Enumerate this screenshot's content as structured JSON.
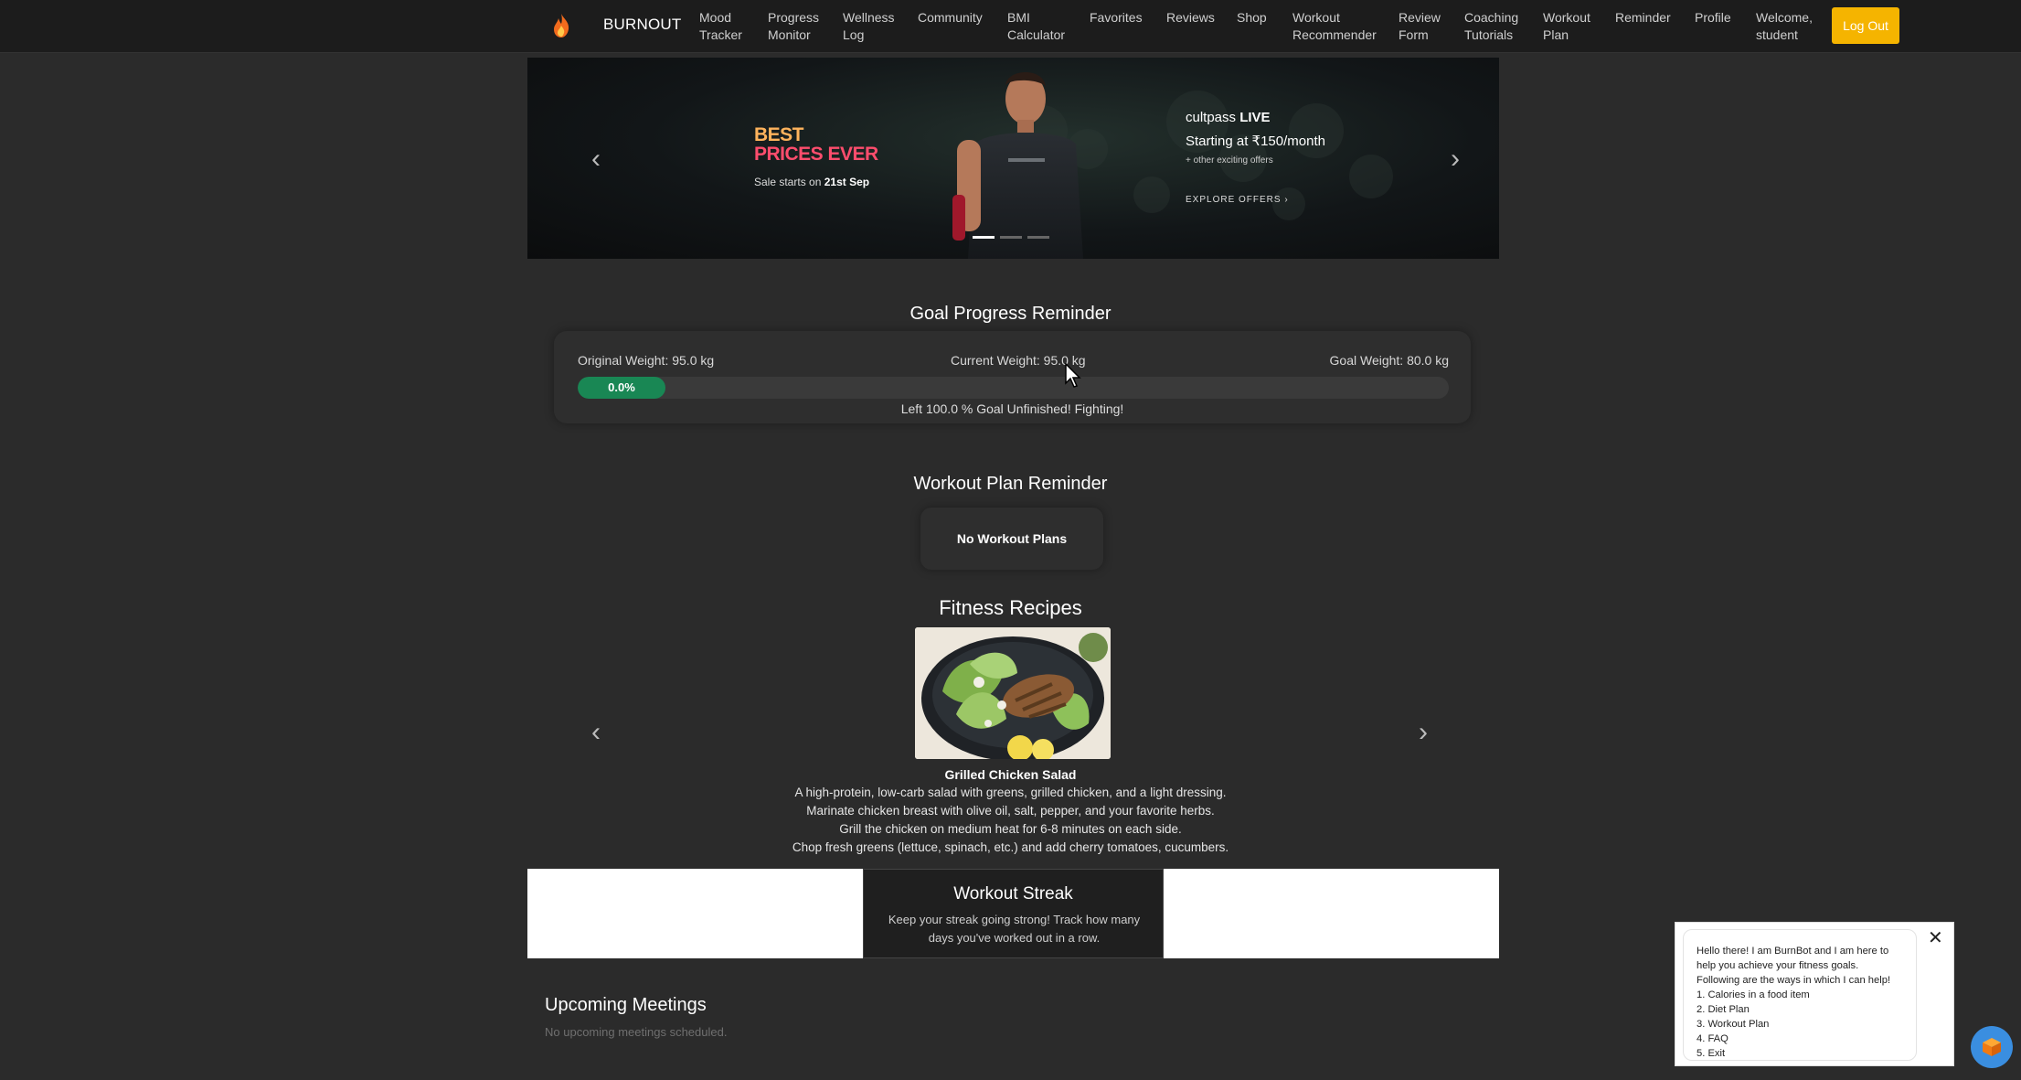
{
  "navbar": {
    "brand": "BURNOUT",
    "items": [
      {
        "line1": "Mood",
        "line2": "Tracker"
      },
      {
        "line1": "Progress",
        "line2": "Monitor"
      },
      {
        "line1": "Wellness",
        "line2": "Log"
      },
      {
        "line1": "Community",
        "line2": ""
      },
      {
        "line1": "BMI",
        "line2": "Calculator"
      },
      {
        "line1": "Favorites",
        "line2": ""
      },
      {
        "line1": "Reviews",
        "line2": ""
      },
      {
        "line1": "Shop",
        "line2": ""
      },
      {
        "line1": "Workout",
        "line2": "Recommender"
      },
      {
        "line1": "Review",
        "line2": "Form"
      },
      {
        "line1": "Coaching",
        "line2": "Tutorials"
      },
      {
        "line1": "Workout",
        "line2": "Plan"
      },
      {
        "line1": "Reminder",
        "line2": ""
      },
      {
        "line1": "Profile",
        "line2": ""
      },
      {
        "line1": "Welcome,",
        "line2": "student"
      }
    ],
    "logout": "Log Out"
  },
  "banner": {
    "headline_1": "BEST",
    "headline_2": "PRICES EVER",
    "sale_prefix": "Sale starts on ",
    "sale_date": "21st Sep",
    "brand": "cultpass",
    "brand_bold": "LIVE",
    "price": "Starting at ₹150/month",
    "other": "+ other exciting offers",
    "explore": "EXPLORE OFFERS ›"
  },
  "goal": {
    "title": "Goal Progress Reminder",
    "original": "Original Weight: 95.0 kg",
    "current": "Current Weight: 95.0 kg",
    "target": "Goal Weight: 80.0 kg",
    "progress_label": "0.0%",
    "progress_value": 0.0,
    "message": "Left 100.0 % Goal Unfinished! Fighting!"
  },
  "workout_plan": {
    "title": "Workout Plan Reminder",
    "empty": "No Workout Plans"
  },
  "recipes": {
    "title": "Fitness Recipes",
    "name": "Grilled Chicken Salad",
    "lines": [
      "A high-protein, low-carb salad with greens, grilled chicken, and a light dressing.",
      "Marinate chicken breast with olive oil, salt, pepper, and your favorite herbs.",
      "Grill the chicken on medium heat for 6-8 minutes on each side.",
      "Chop fresh greens (lettuce, spinach, etc.) and add cherry tomatoes, cucumbers."
    ]
  },
  "streak": {
    "title": "Workout Streak",
    "desc": "Keep your streak going strong! Track how many days you've worked out in a row."
  },
  "meetings": {
    "title": "Upcoming Meetings",
    "empty": "No upcoming meetings scheduled."
  },
  "chatbot": {
    "lines": [
      "Hello there! I am BurnBot and I am here to",
      "help you achieve your fitness goals.",
      "Following are the ways in which I can help!",
      "1. Calories in a food item",
      "2. Diet Plan",
      "3. Workout Plan",
      "4. FAQ",
      "5. Exit"
    ],
    "close": "✕"
  },
  "colors": {
    "accent": "#f5b400",
    "progress": "#198754",
    "background": "#2b2b2b",
    "navbar": "#1c1c1c"
  }
}
